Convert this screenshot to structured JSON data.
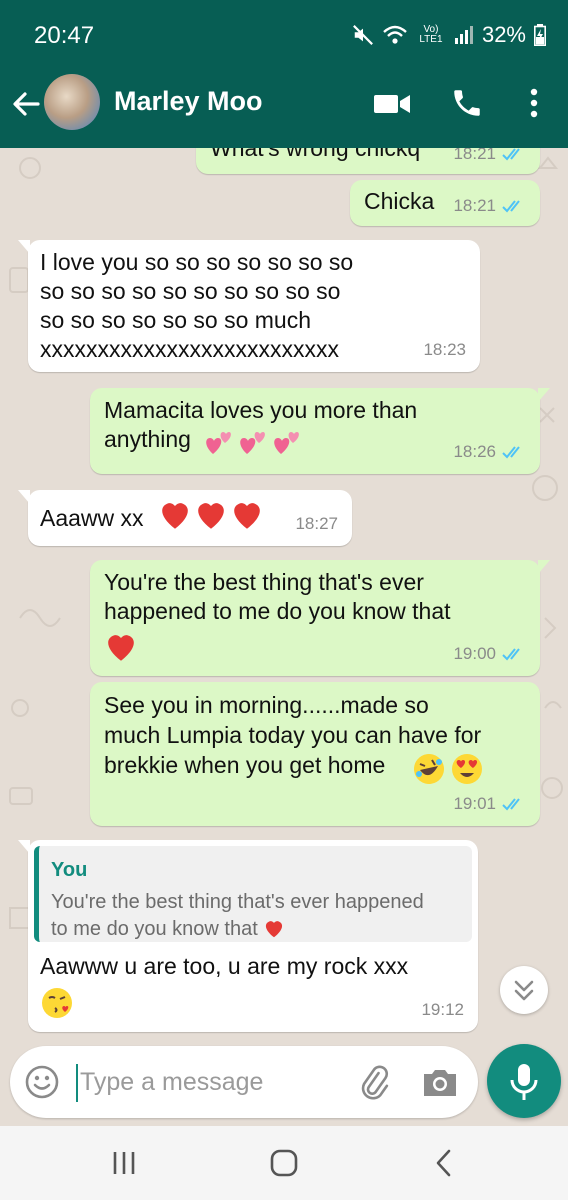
{
  "status_bar": {
    "time": "20:47",
    "network": "Vo) LTE1",
    "battery": "32%",
    "icons": [
      "mute-icon",
      "wifi-icon",
      "signal-icon",
      "battery-charging-icon"
    ]
  },
  "header": {
    "contact_name": "Marley Moo",
    "icons": [
      "back-arrow-icon",
      "video-call-icon",
      "phone-icon",
      "more-vert-icon"
    ]
  },
  "colors": {
    "header": "#075e54",
    "accent": "#128c7e",
    "outgoing_bubble": "#dcf8c6",
    "incoming_bubble": "#ffffff",
    "read_tick": "#4fc3f7",
    "wallpaper": "#e5ddd5"
  },
  "messages": [
    {
      "direction": "out",
      "text": "What's wrong chickq",
      "time": "18:21",
      "status": "read"
    },
    {
      "direction": "out",
      "text": "Chicka",
      "time": "18:21",
      "status": "read"
    },
    {
      "direction": "in",
      "text": "I love you so so so so so so so\nso so so so so so so so so so\nso so so so so so so much\nxxxxxxxxxxxxxxxxxxxxxxxxxx",
      "time": "18:23"
    },
    {
      "direction": "out",
      "text": "Mamacita loves you more than\nanything",
      "emoji": "two-hearts x3",
      "time": "18:26",
      "status": "read"
    },
    {
      "direction": "in",
      "text": "Aaaww xx",
      "emoji": "red-heart x3",
      "time": "18:27"
    },
    {
      "direction": "out",
      "text": "You're the best thing that's ever\nhappened to me do you know that",
      "emoji": "red-heart",
      "time": "19:00",
      "status": "read"
    },
    {
      "direction": "out",
      "text": "See you in morning......made so\nmuch Lumpia today you can have for\nbrekkie when you get home",
      "emoji": "rolling-laughing, heart-eyes",
      "time": "19:01",
      "status": "read"
    },
    {
      "direction": "in",
      "quote": {
        "author": "You",
        "text": "You're the best thing that's ever happened\nto me do you know that"
      },
      "text": "Aawww u are too, u are my rock xxx",
      "emoji": "face-blowing-kiss",
      "time": "19:12"
    }
  ],
  "composer": {
    "placeholder": "Type a message",
    "icons": [
      "emoji-icon",
      "attach-icon",
      "camera-icon",
      "mic-icon"
    ]
  },
  "nav": {
    "icons": [
      "recents-icon",
      "home-icon",
      "back-icon"
    ]
  }
}
